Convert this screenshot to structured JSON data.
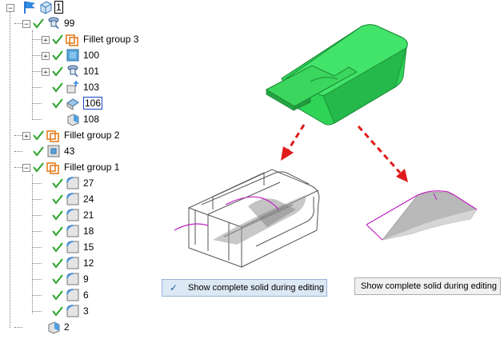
{
  "root": {
    "label": "1"
  },
  "tree": [
    {
      "id": "n99",
      "label": "99",
      "level": 1,
      "expander": "-",
      "icon": "feature-lamp-icon",
      "check": true
    },
    {
      "id": "fg3",
      "label": "Fillet group 3",
      "level": 2,
      "expander": "+",
      "icon": "fillet-group-icon",
      "check": true
    },
    {
      "id": "n100",
      "label": "100",
      "level": 2,
      "expander": "+",
      "icon": "surface-icon",
      "check": true
    },
    {
      "id": "n101",
      "label": "101",
      "level": 2,
      "expander": "+",
      "icon": "feature-lamp-icon",
      "check": true
    },
    {
      "id": "n103",
      "label": "103",
      "level": 2,
      "expander": "",
      "icon": "point-move-icon",
      "check": true
    },
    {
      "id": "n106",
      "label": "106",
      "level": 2,
      "expander": "",
      "icon": "blend-icon",
      "check": true,
      "selected": true
    },
    {
      "id": "n108",
      "label": "108",
      "level": 2,
      "expander": "",
      "icon": "solid-block-icon",
      "check": false
    },
    {
      "id": "fg2",
      "label": "Fillet group 2",
      "level": 1,
      "expander": "+",
      "icon": "fillet-group-icon",
      "check": true
    },
    {
      "id": "n43",
      "label": "43",
      "level": 1,
      "expander": "",
      "icon": "block-face-icon",
      "check": true
    },
    {
      "id": "fg1",
      "label": "Fillet group 1",
      "level": 1,
      "expander": "-",
      "icon": "fillet-group-icon",
      "check": true
    },
    {
      "id": "n27",
      "label": "27",
      "level": 2,
      "expander": "",
      "icon": "fillet-icon",
      "check": true
    },
    {
      "id": "n24",
      "label": "24",
      "level": 2,
      "expander": "",
      "icon": "fillet-icon",
      "check": true
    },
    {
      "id": "n21",
      "label": "21",
      "level": 2,
      "expander": "",
      "icon": "fillet-icon",
      "check": true
    },
    {
      "id": "n18",
      "label": "18",
      "level": 2,
      "expander": "",
      "icon": "fillet-icon",
      "check": true
    },
    {
      "id": "n15",
      "label": "15",
      "level": 2,
      "expander": "",
      "icon": "fillet-icon",
      "check": true
    },
    {
      "id": "n12",
      "label": "12",
      "level": 2,
      "expander": "",
      "icon": "fillet-icon",
      "check": true
    },
    {
      "id": "n9",
      "label": "9",
      "level": 2,
      "expander": "",
      "icon": "fillet-icon",
      "check": true
    },
    {
      "id": "n6",
      "label": "6",
      "level": 2,
      "expander": "",
      "icon": "fillet-icon",
      "check": true
    },
    {
      "id": "n3",
      "label": "3",
      "level": 2,
      "expander": "",
      "icon": "fillet-icon",
      "check": true
    },
    {
      "id": "n2",
      "label": "2",
      "level": 1,
      "expander": "",
      "icon": "solid-block-icon",
      "check": false
    }
  ],
  "options": {
    "enabled_label": "Show complete solid during editing",
    "disabled_label": "Show complete solid during editing",
    "check_glyph": "✓"
  },
  "colors": {
    "solid_green": "#2fd457",
    "arrow_red": "#e01b1b",
    "edge_magenta": "#c020c0",
    "check_green": "#2aa52a",
    "fillet_orange": "#e67e22",
    "select_blue": "#1a46c8"
  }
}
